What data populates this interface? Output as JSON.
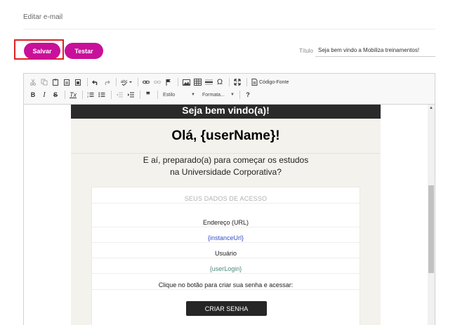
{
  "page": {
    "title": "Editar e-mail"
  },
  "actions": {
    "save_label": "Salvar",
    "test_label": "Testar"
  },
  "title_field": {
    "label": "Título",
    "value": "Seja bem vindo a Mobiliza treinamentos!"
  },
  "toolbar": {
    "source_label": "Código-Fonte",
    "style_combo": "Estilo",
    "format_combo": "Formata...",
    "bold": "B",
    "italic": "I",
    "strike": "S",
    "remove_format": "Tx",
    "help": "?",
    "quote": "❞",
    "omega": "Ω"
  },
  "email": {
    "header": "Seja bem vindo(a)!",
    "greeting": "Olá, {userName}!",
    "intro_line1": "E aí, preparado(a) para começar os estudos",
    "intro_line2": "na Universidade Corporativa?",
    "card": {
      "title": "SEUS DADOS DE ACESSO",
      "address_label": "Endereço (URL)",
      "address_value": "{instanceUrl}",
      "user_label": "Usuário",
      "user_value": "{userLogin}",
      "instruction": "Clique no botão para criar sua senha e acessar:",
      "cta_label": "CRIAR SENHA"
    }
  },
  "colors": {
    "brand": "#c8109a",
    "header_bg": "#2a2a2a",
    "mail_bg": "#f4f2ec",
    "highlight": "#e02020"
  }
}
